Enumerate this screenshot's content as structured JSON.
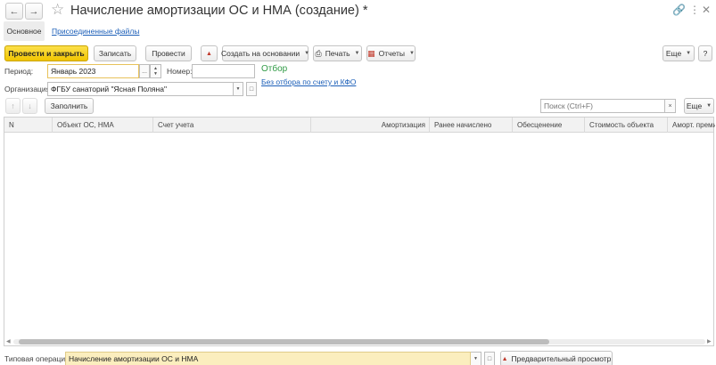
{
  "window": {
    "title": "Начисление амортизации ОС и НМА (создание) *"
  },
  "tabs": {
    "main": "Основное",
    "files": "Присоединенные файлы"
  },
  "toolbar": {
    "post_close": "Провести и закрыть",
    "save": "Записать",
    "post": "Провести",
    "create_based": "Создать на основании",
    "print": "Печать",
    "reports": "Отчеты",
    "more": "Еще"
  },
  "form": {
    "period_label": "Период:",
    "period_value": "Январь 2023",
    "number_label": "Номер:",
    "number_value": "",
    "org_label": "Организация:",
    "org_value": "ФГБУ санаторий \"Ясная Поляна\"",
    "filter_title": "Отбор",
    "filter_link": "Без отбора по счету и КФО"
  },
  "table_toolbar": {
    "fill": "Заполнить",
    "search_placeholder": "Поиск (Ctrl+F)",
    "more": "Еще"
  },
  "table": {
    "columns": [
      "N",
      "Объект ОС, НМА",
      "Счет учета",
      "Амортизация",
      "Ранее начислено",
      "Обесценение",
      "Стоимость объекта",
      "Аморт. преми"
    ]
  },
  "footer": {
    "op_label": "Типовая операция:",
    "op_value": "Начисление амортизации ОС и НМА",
    "preview": "Предварительный просмотр"
  }
}
